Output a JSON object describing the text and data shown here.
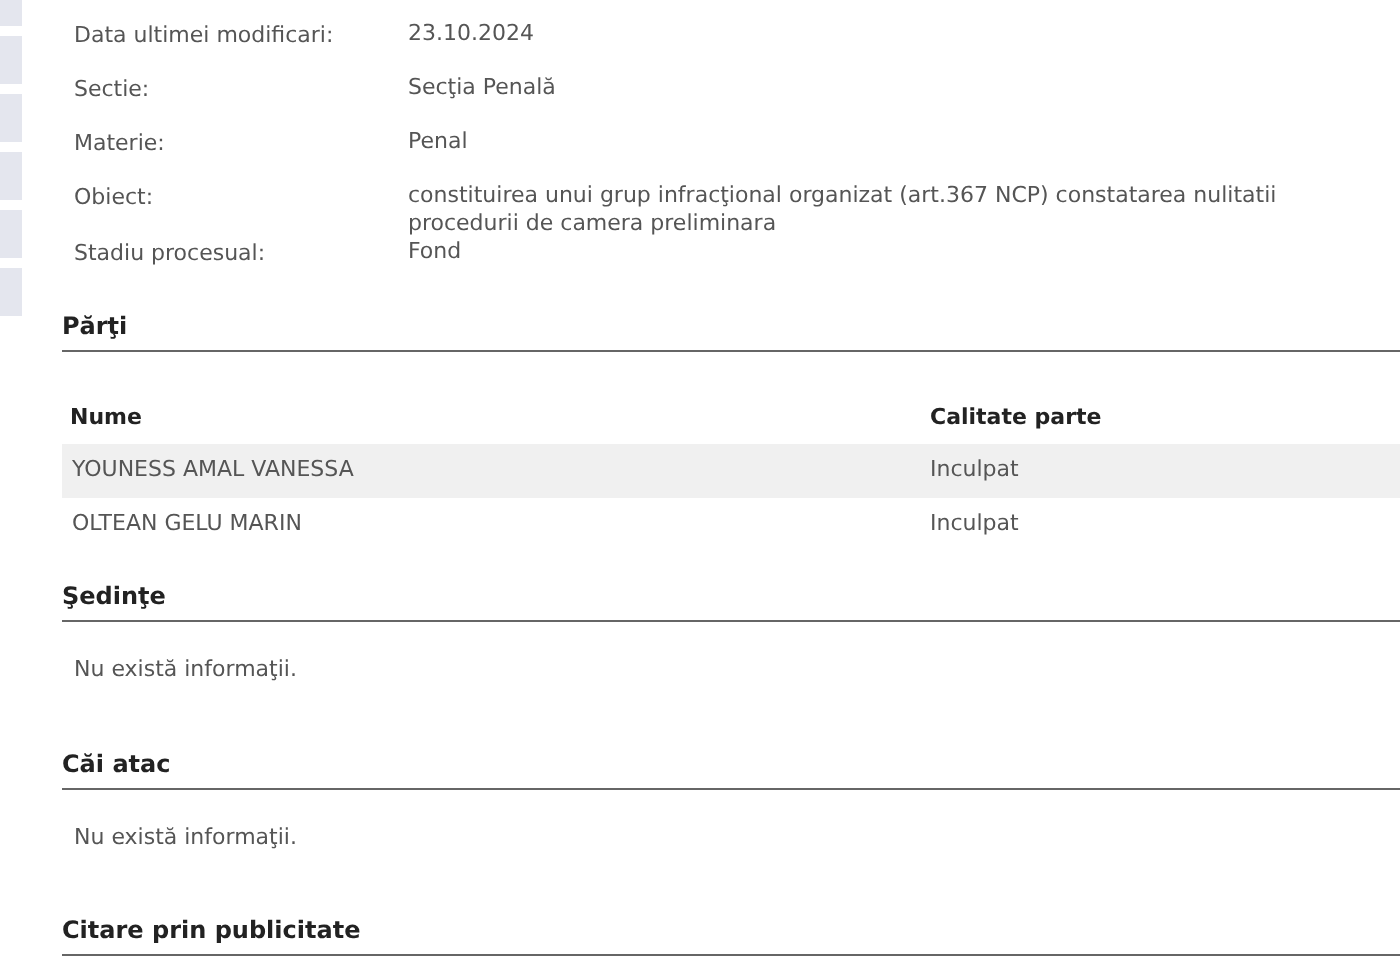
{
  "details": [
    {
      "label": "Data ultimei modificari:",
      "value": "23.10.2024"
    },
    {
      "label": "Sectie:",
      "value": "Secţia Penală"
    },
    {
      "label": "Materie:",
      "value": "Penal"
    },
    {
      "label": "Obiect:",
      "value": "constituirea unui grup infracţional organizat (art.367 NCP) constatarea nulitatii procedurii de camera preliminara"
    },
    {
      "label": "Stadiu procesual:",
      "value": "Fond"
    }
  ],
  "sections": [
    {
      "kind": "table",
      "title": "Părţi",
      "columns": [
        "Nume",
        "Calitate parte"
      ],
      "rows": [
        [
          "YOUNESS AMAL VANESSA",
          "Inculpat"
        ],
        [
          "OLTEAN GELU MARIN",
          "Inculpat"
        ]
      ]
    },
    {
      "kind": "empty",
      "title": "Şedinţe",
      "message": "Nu există informaţii."
    },
    {
      "kind": "empty",
      "title": "Căi atac",
      "message": "Nu există informaţii."
    },
    {
      "kind": "heading",
      "title": "Citare prin publicitate"
    }
  ]
}
